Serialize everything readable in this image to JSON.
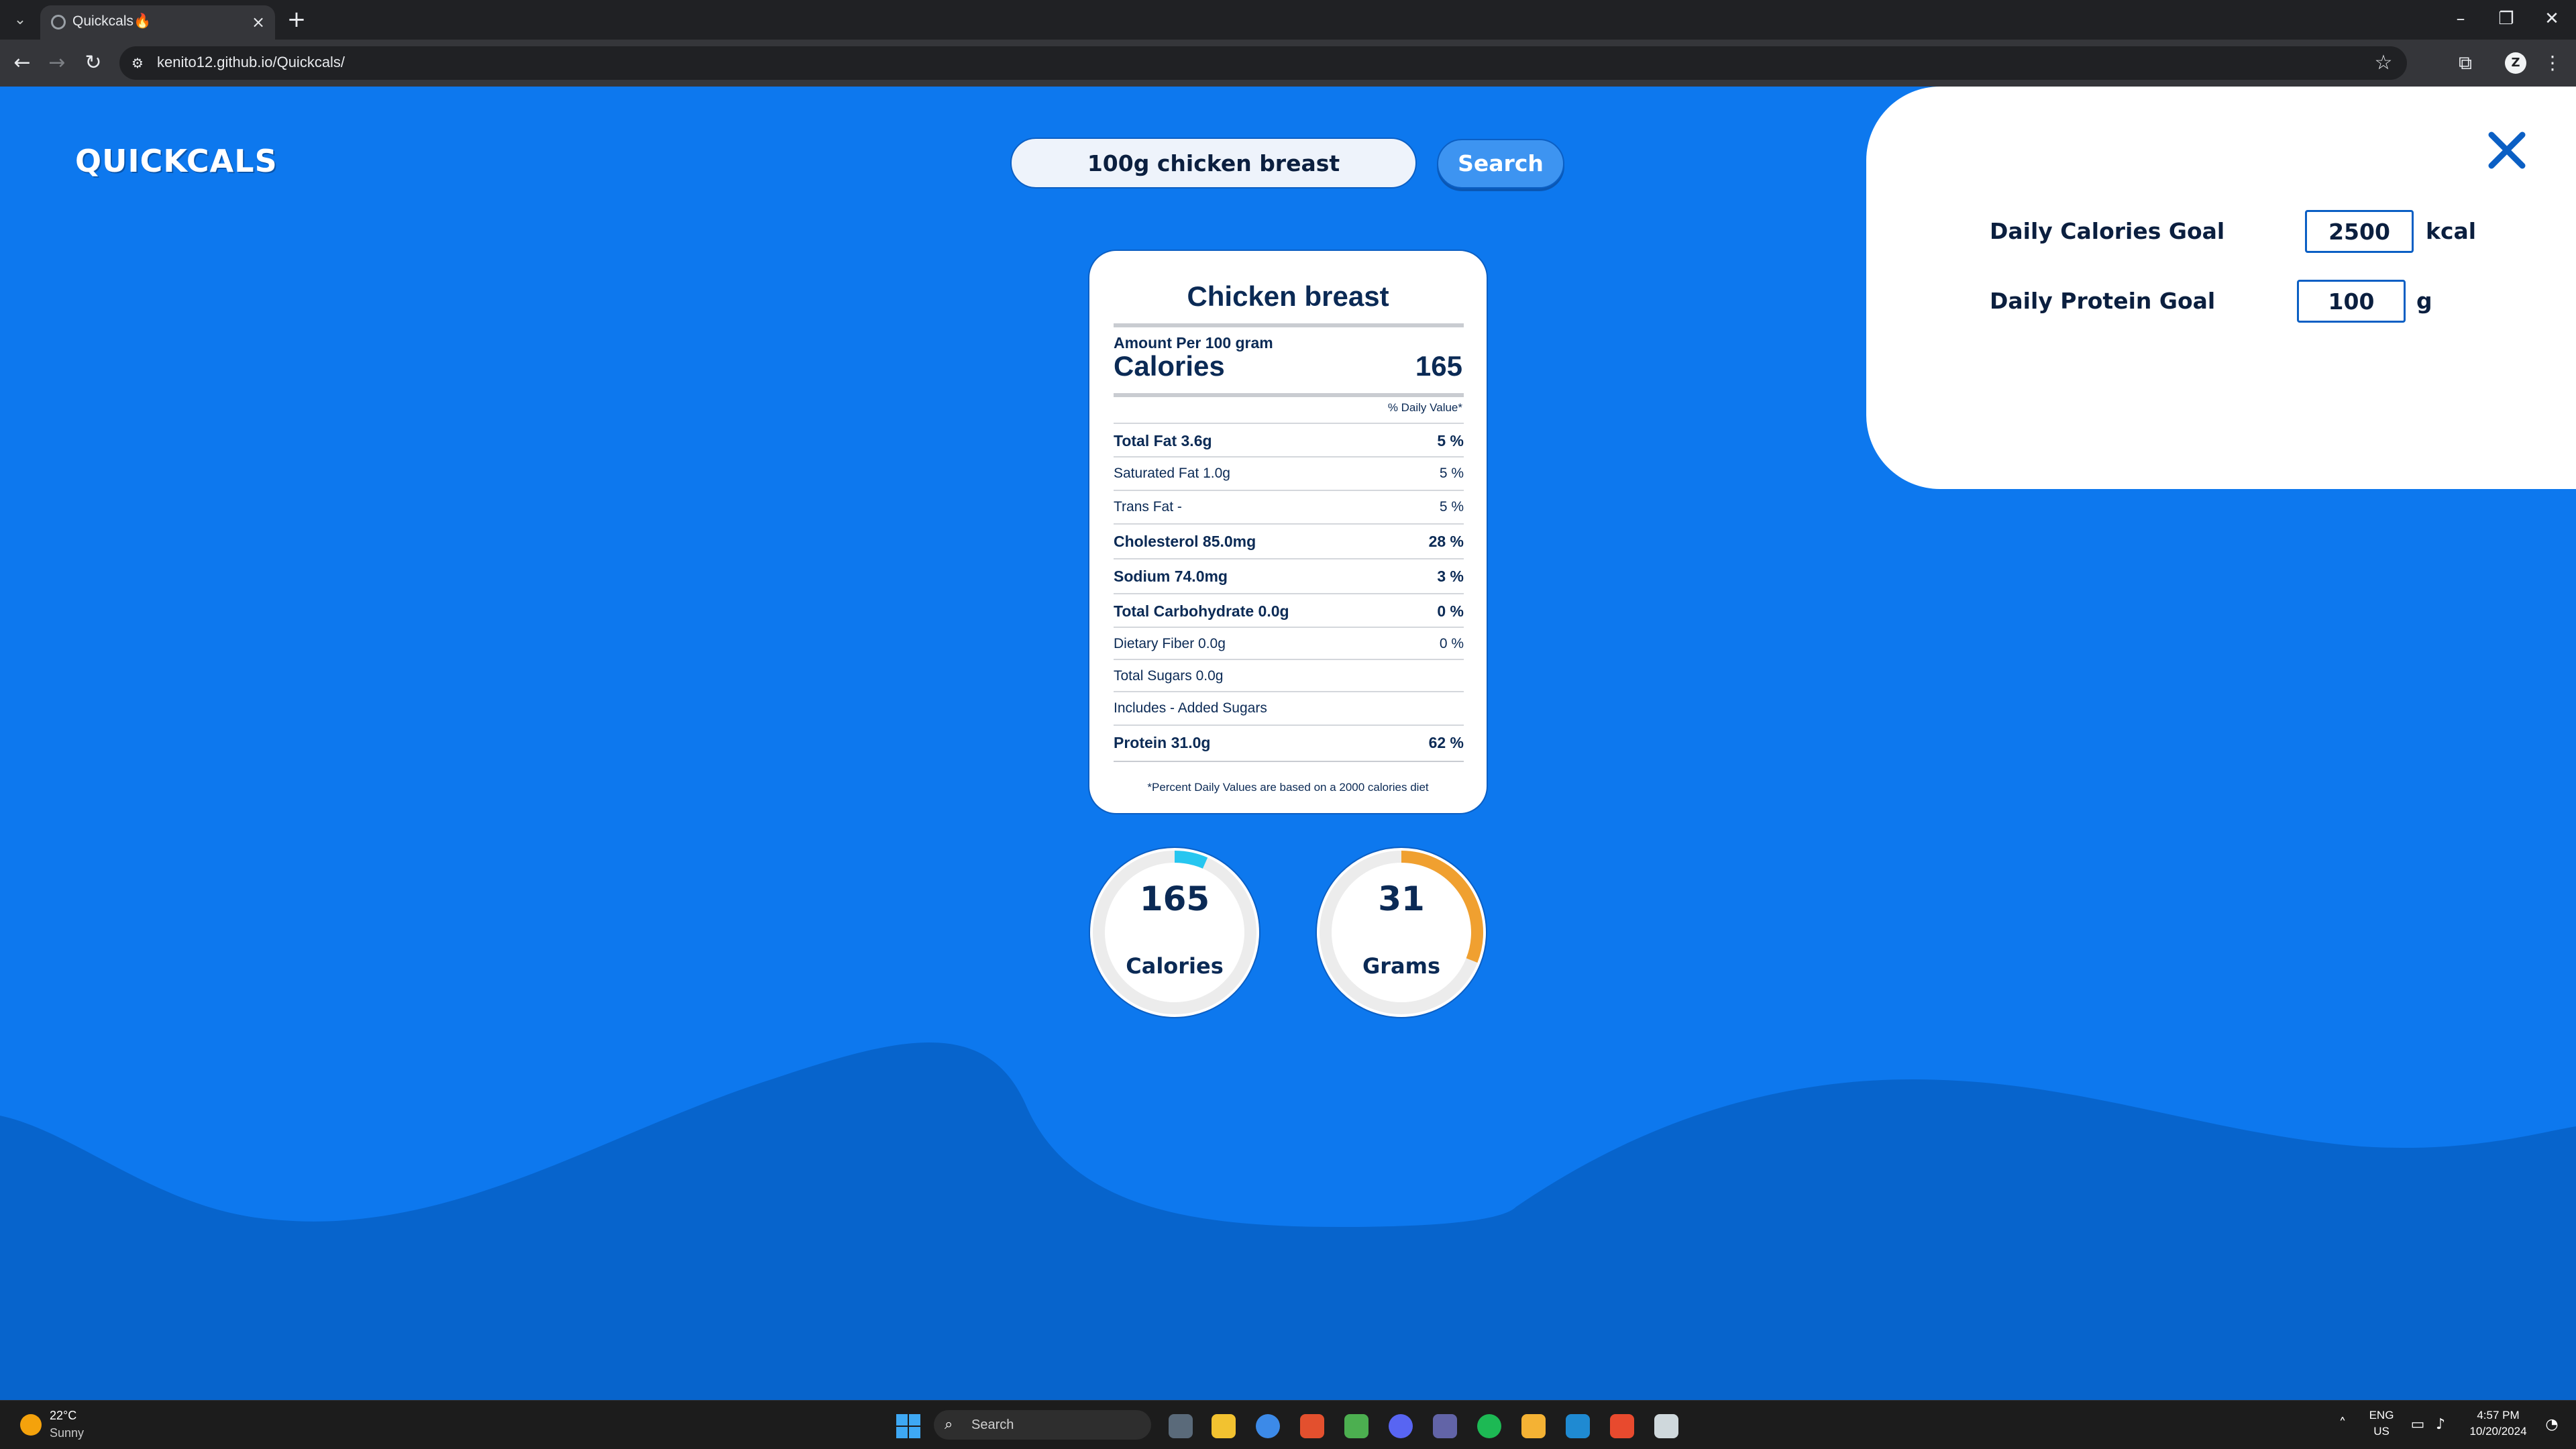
{
  "browser": {
    "tab_title": "Quickcals🔥",
    "url": "kenito12.github.io/Quickcals/"
  },
  "app": {
    "logo": "QUICKCALS",
    "search": {
      "value": "100g chicken breast",
      "button_label": "Search"
    }
  },
  "nutrition": {
    "food_name": "Chicken breast",
    "amount_per": "Amount Per 100 gram",
    "calories_label": "Calories",
    "calories_value": "165",
    "daily_value_header": "% Daily Value*",
    "rows": [
      {
        "label": "Total Fat 3.6g",
        "percent": "5 %",
        "bold": true
      },
      {
        "label": "Saturated Fat 1.0g",
        "percent": "5 %",
        "bold": false
      },
      {
        "label": "Trans Fat -",
        "percent": "5 %",
        "bold": false
      },
      {
        "label": "Cholesterol 85.0mg",
        "percent": "28 %",
        "bold": true
      },
      {
        "label": "Sodium 74.0mg",
        "percent": "3 %",
        "bold": true
      },
      {
        "label": "Total Carbohydrate 0.0g",
        "percent": "0 %",
        "bold": true
      },
      {
        "label": "Dietary Fiber 0.0g",
        "percent": "0 %",
        "bold": false
      },
      {
        "label": "Total Sugars 0.0g",
        "percent": "",
        "bold": false
      },
      {
        "label": "Includes - Added Sugars",
        "percent": "",
        "bold": false
      },
      {
        "label": "Protein 31.0g",
        "percent": "62 %",
        "bold": true
      }
    ],
    "footnote": "*Percent Daily Values are based on a 2000 calories diet"
  },
  "progress": {
    "calories": {
      "value": "165",
      "label": "Calories",
      "fraction": 0.066,
      "color": "#26c6f0"
    },
    "protein": {
      "value": "31",
      "label": "Grams",
      "fraction": 0.31,
      "color": "#f0a030"
    }
  },
  "goals": {
    "calories_label": "Daily Calories Goal",
    "calories_value": "2500",
    "calories_unit": "kcal",
    "protein_label": "Daily Protein Goal",
    "protein_value": "100",
    "protein_unit": "g"
  },
  "taskbar": {
    "weather_temp": "22°C",
    "weather_desc": "Sunny",
    "search_placeholder": "Search",
    "lang_top": "ENG",
    "lang_bottom": "US",
    "time": "4:57 PM",
    "date": "10/20/2024"
  },
  "colors": {
    "page_bg": "#0d78ee",
    "wave": "#0764cc",
    "accent": "#0b5fc4"
  }
}
